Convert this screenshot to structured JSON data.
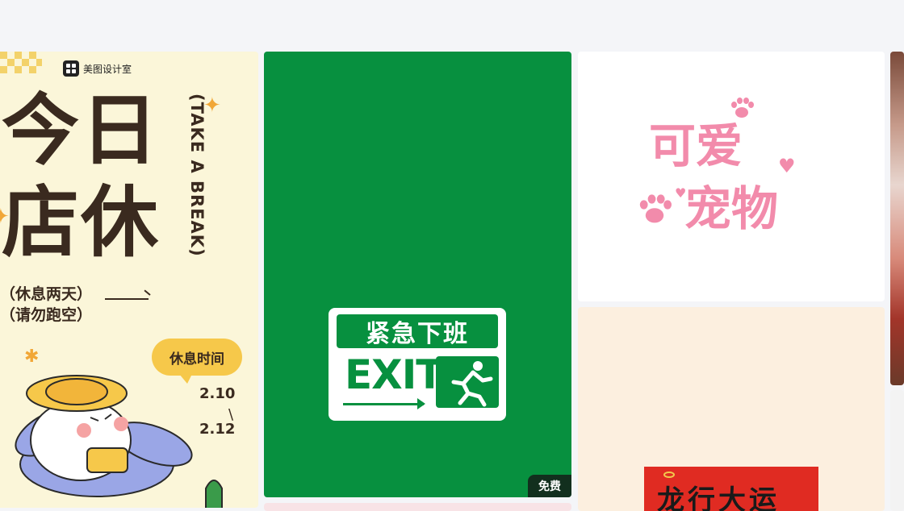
{
  "cards": {
    "closed": {
      "brand": "美图设计室",
      "title_line1": "今日",
      "title_line2": "店休",
      "english": "(TAKE A BREAK)",
      "sub1": "（休息两天）",
      "sub2": "（请勿跑空）",
      "bubble": "休息时间",
      "date_start": "2.10",
      "date_end": "2.12"
    },
    "exit": {
      "banner": "紧急下班",
      "word": "EXIT",
      "badge": "免费",
      "bg_color": "#07903f"
    },
    "pet": {
      "line1": "可爱",
      "line2": "宠物",
      "color": "#f28bab"
    },
    "dragon": {
      "text": "龙行大运",
      "bg_color": "#e02b22"
    }
  }
}
